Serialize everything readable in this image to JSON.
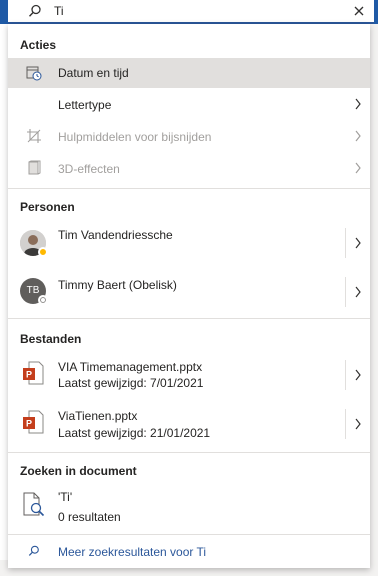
{
  "search": {
    "value": "Ti",
    "placeholder": ""
  },
  "sections": {
    "acties": {
      "title": "Acties",
      "items": [
        {
          "label": "Datum en tijd",
          "icon": "calendar-clock-icon",
          "highlighted": true
        },
        {
          "label": "Lettertype",
          "icon": "",
          "has_submenu": true
        },
        {
          "label": "Hulpmiddelen voor bijsnijden",
          "icon": "crop-icon",
          "disabled": true,
          "has_submenu": true
        },
        {
          "label": "3D-effecten",
          "icon": "cube-icon",
          "disabled": true,
          "has_submenu": true
        }
      ]
    },
    "personen": {
      "title": "Personen",
      "items": [
        {
          "name": "Tim Vandendriessche",
          "initials": ""
        },
        {
          "name": "Timmy Baert (Obelisk)",
          "initials": "TB"
        }
      ]
    },
    "bestanden": {
      "title": "Bestanden",
      "items": [
        {
          "name": "VIA Timemanagement.pptx",
          "modified": "Laatst gewijzigd: 7/01/2021"
        },
        {
          "name": "ViaTienen.pptx",
          "modified": "Laatst gewijzigd: 21/01/2021"
        }
      ]
    },
    "zoeken": {
      "title": "Zoeken in document",
      "query": "'Ti'",
      "results": "0 resultaten"
    }
  },
  "more_results": "Meer zoekresultaten voor Ti",
  "colors": {
    "accent": "#2b579a",
    "powerpoint": "#c43e1c",
    "highlight": "#e1dfdd"
  }
}
